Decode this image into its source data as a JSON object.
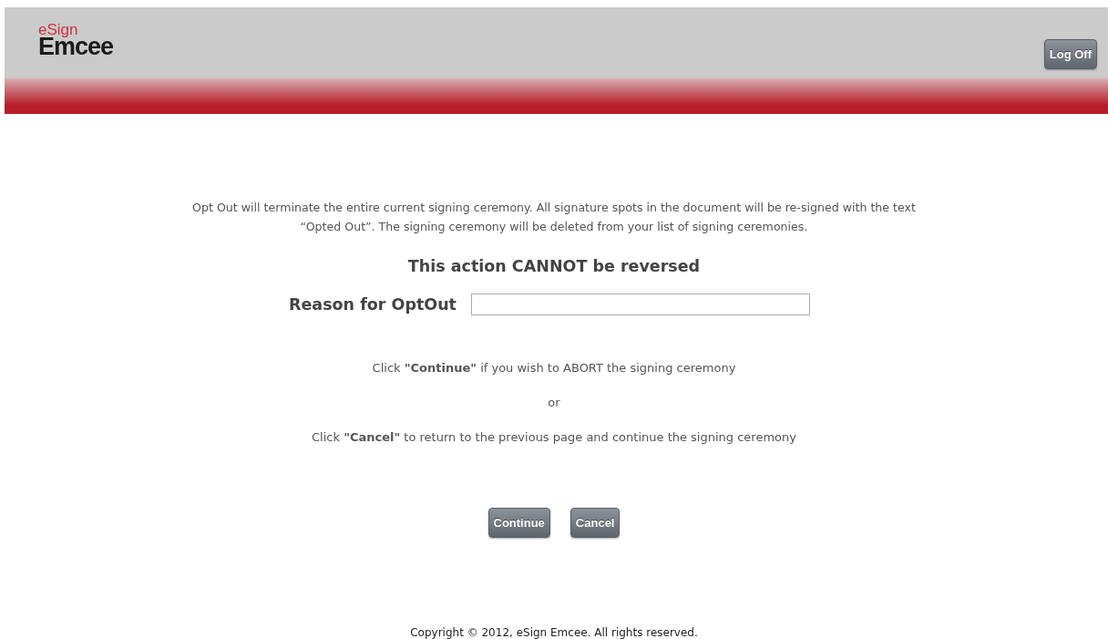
{
  "header": {
    "logo": {
      "top": "eSign",
      "bottom": "Emcee"
    },
    "log_off": "Log Off"
  },
  "notice": "Opt Out will terminate the entire current signing ceremony. All signature spots in the document will be re-signed with the text “Opted Out”. The signing ceremony will be deleted from your list of signing ceremonies.",
  "warning": "This action CANNOT be reversed",
  "reason": {
    "label": "Reason for OptOut"
  },
  "instructions": [
    "Click **\"Continue\"** if you wish to ABORT the signing ceremony",
    "or",
    "Click **\"Cancel\"** to return to the previous page and continue the signing ceremony"
  ],
  "buttons": [
    "Continue",
    "Cancel"
  ],
  "footer": "Copyright © 2012, eSign Emcee. All rights reserved."
}
